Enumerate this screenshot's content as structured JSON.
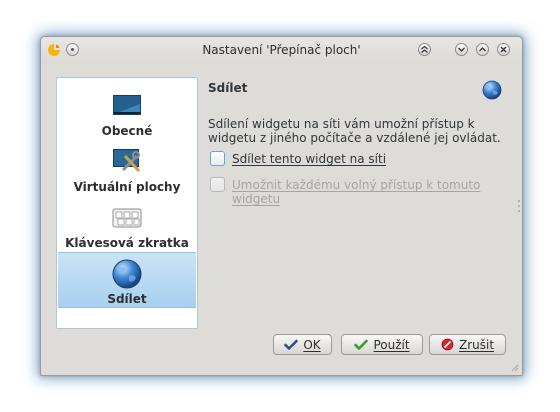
{
  "window": {
    "title": "Nastavení 'Přepínač ploch'",
    "colors": {
      "selection": "#a9d0ee",
      "focus_glow": "#3f8fd0"
    }
  },
  "sidebar": {
    "items": [
      {
        "label": "Obecné",
        "icon": "desktop-icon",
        "selected": false
      },
      {
        "label": "Virtuální plochy",
        "icon": "virtual-desktops-tools-icon",
        "selected": false
      },
      {
        "label": "Klávesová zkratka",
        "icon": "keyboard-icon",
        "selected": false
      },
      {
        "label": "Sdílet",
        "icon": "globe-icon",
        "selected": true
      }
    ]
  },
  "content": {
    "title": "Sdílet",
    "description": "Sdílení widgetu na síti vám umožní přístup k widgetu z jiného počítače a vzdálené jej ovládat.",
    "share_checkbox": {
      "label": "Sdílet tento widget na síti",
      "checked": false
    },
    "free_access_checkbox": {
      "label": "Umožnit každému volný přístup k tomuto widgetu",
      "checked": false,
      "enabled": false
    }
  },
  "buttons": {
    "ok": "OK",
    "apply": "Použít",
    "cancel": "Zrušit"
  }
}
